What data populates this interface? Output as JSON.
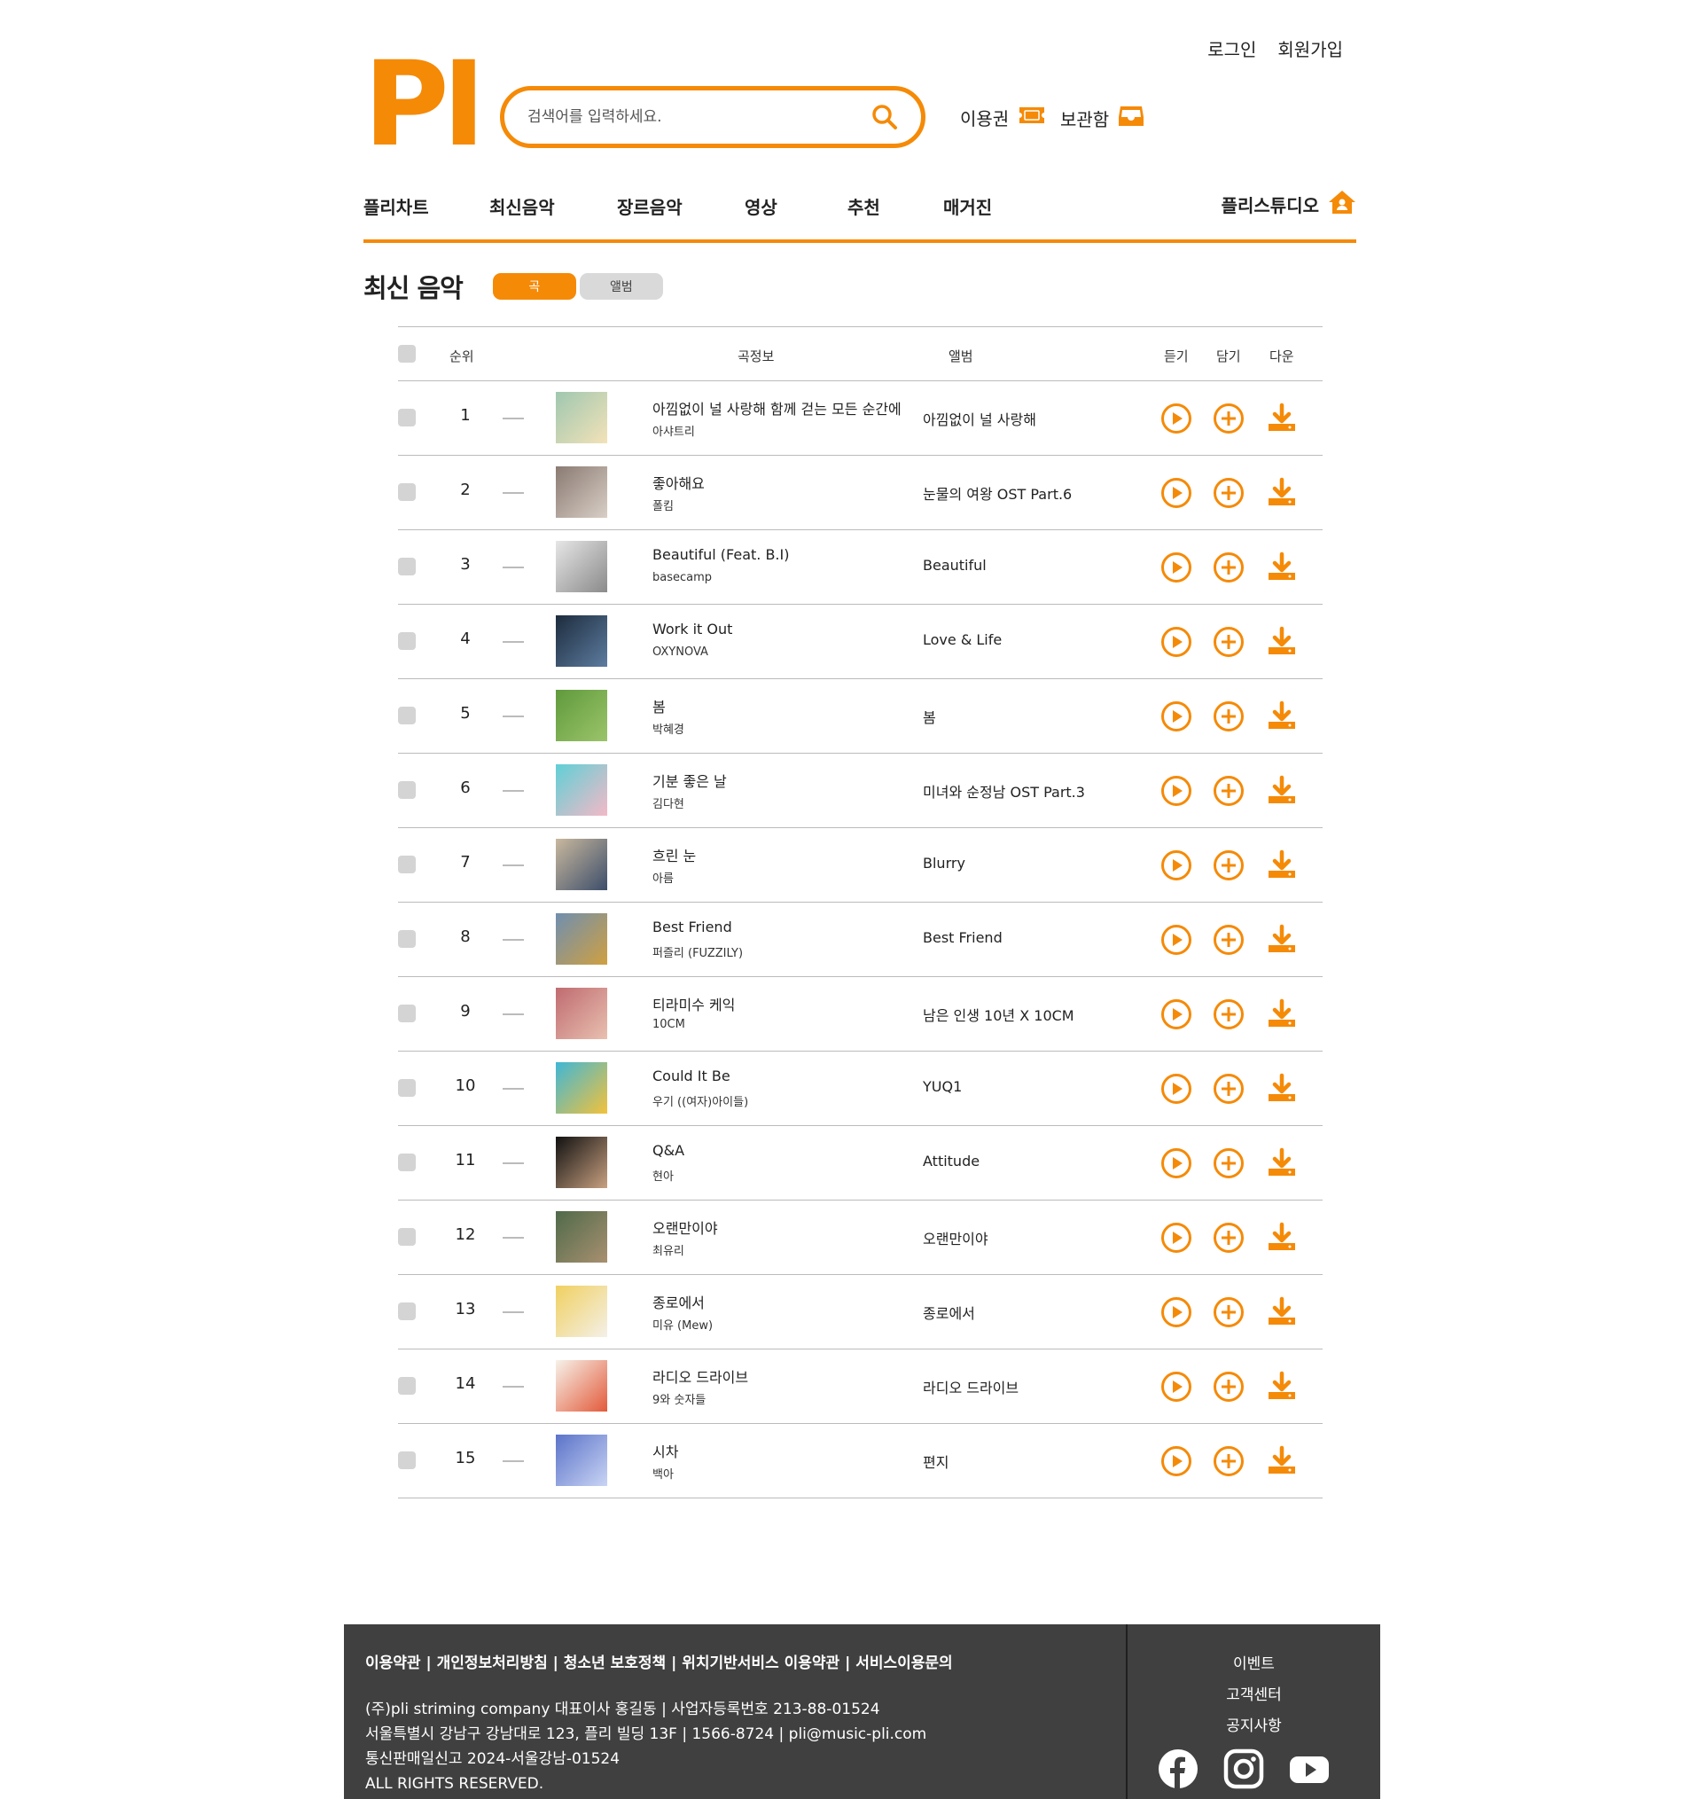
{
  "header": {
    "login": "로그인",
    "signup": "회원가입",
    "logo": "PI",
    "search_placeholder": "검색어를 입력하세요.",
    "pass_label": "이용권",
    "locker_label": "보관함"
  },
  "nav": {
    "items": [
      "플리차트",
      "최신음악",
      "장르음악",
      "영상",
      "추천",
      "매거진"
    ],
    "studio": "플리스튜디오"
  },
  "section": {
    "title": "최신 음악",
    "tab_song": "곡",
    "tab_album": "앨범"
  },
  "table": {
    "headers": {
      "rank": "순위",
      "info": "곡정보",
      "album": "앨범",
      "listen": "듣기",
      "add": "담기",
      "download": "다운"
    },
    "rows": [
      {
        "rank": "1",
        "title": "아낌없이 널 사랑해 함께 걷는 모든 순간에",
        "artist": "아샤트리",
        "album": "아낌없이 널 사랑해",
        "cover": [
          "#9fc7b0",
          "#f3e2b8"
        ]
      },
      {
        "rank": "2",
        "title": "좋아해요",
        "artist": "폴킴",
        "album": "눈물의 여왕 OST Part.6",
        "cover": [
          "#8a7a72",
          "#d9cfc6"
        ]
      },
      {
        "rank": "3",
        "title": "Beautiful (Feat. B.I)",
        "artist": "basecamp",
        "album": "Beautiful",
        "cover": [
          "#e6e6e6",
          "#8a8a8a"
        ]
      },
      {
        "rank": "4",
        "title": "Work it Out",
        "artist": "OXYNOVA",
        "album": "Love & Life",
        "cover": [
          "#1d2c3d",
          "#5d7ca0"
        ]
      },
      {
        "rank": "5",
        "title": "봄",
        "artist": "박혜경",
        "album": "봄",
        "cover": [
          "#5f9a3c",
          "#9cc46a"
        ]
      },
      {
        "rank": "6",
        "title": "기분 좋은 날",
        "artist": "김다현",
        "album": "미녀와 순정남 OST Part.3",
        "cover": [
          "#5fd0d6",
          "#f4b9c7"
        ]
      },
      {
        "rank": "7",
        "title": "흐린 눈",
        "artist": "아름",
        "album": "Blurry",
        "cover": [
          "#c9b89e",
          "#3c4e6a"
        ]
      },
      {
        "rank": "8",
        "title": "Best Friend",
        "artist": "퍼즐리 (FUZZILY)",
        "album": "Best Friend",
        "cover": [
          "#6f8fb0",
          "#d0a040"
        ]
      },
      {
        "rank": "9",
        "title": "티라미수 케익",
        "artist": "10CM",
        "album": "남은 인생 10년 X 10CM",
        "cover": [
          "#c06b70",
          "#e8c0b0"
        ]
      },
      {
        "rank": "10",
        "title": "Could It Be",
        "artist": "우기 ((여자)아이들)",
        "album": "YUQ1",
        "cover": [
          "#3fb7d6",
          "#f3c23a"
        ]
      },
      {
        "rank": "11",
        "title": "Q&A",
        "artist": "현아",
        "album": "Attitude",
        "cover": [
          "#111111",
          "#c8a080"
        ]
      },
      {
        "rank": "12",
        "title": "오랜만이야",
        "artist": "최유리",
        "album": "오랜만이야",
        "cover": [
          "#4f6a4a",
          "#a89070"
        ]
      },
      {
        "rank": "13",
        "title": "종로에서",
        "artist": "미유 (Mew)",
        "album": "종로에서",
        "cover": [
          "#f0d060",
          "#f4f0e8"
        ]
      },
      {
        "rank": "14",
        "title": "라디오 드라이브",
        "artist": "9와 숫자들",
        "album": "라디오 드라이브",
        "cover": [
          "#f6f2ea",
          "#e35a3a"
        ]
      },
      {
        "rank": "15",
        "title": "시차",
        "artist": "백아",
        "album": "편지",
        "cover": [
          "#5b73c9",
          "#c9d4f4"
        ]
      }
    ]
  },
  "footer": {
    "links": "이용약관 | 개인정보처리방침 | 청소년 보호정책 | 위치기반서비스 이용약관 | 서비스이용문의",
    "company": "(주)pli striming company 대표이사 홍길동 | 사업자등록번호 213-88-01524",
    "address": "서울특별시 강남구 강남대로 123, 플리 빌딩 13F | 1566-8724 | pli@music-pli.com",
    "registration": "통신판매일신고 2024-서울강남-01524",
    "rights": "ALL RIGHTS RESERVED.",
    "menu": [
      "이벤트",
      "고객센터",
      "공지사항"
    ]
  },
  "colors": {
    "accent": "#F58A07",
    "footer_bg": "#404040"
  }
}
